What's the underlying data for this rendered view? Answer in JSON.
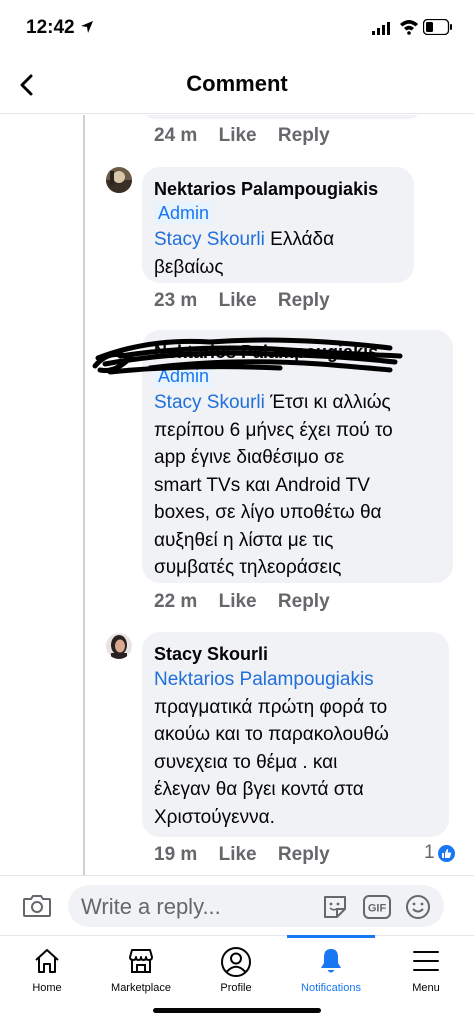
{
  "status_bar": {
    "time": "12:42"
  },
  "header": {
    "title": "Comment"
  },
  "comments": [
    {
      "time": "24 m",
      "like": "Like",
      "reply": "Reply"
    },
    {
      "author": "Nektarios Palampougiakis",
      "badge": "Admin",
      "mention": "Stacy Skourli",
      "text_first": " Ελλάδα",
      "text_lines": [
        "βεβαίως"
      ],
      "time": "23 m",
      "like": "Like",
      "reply": "Reply"
    },
    {
      "author": "Nektarios Palampougiakis",
      "badge": "Admin",
      "mention": "Stacy Skourli",
      "text_first": " Έτσι κι αλλιώς",
      "text_lines": [
        "περίπου 6 μήνες έχει πού το",
        "app έγινε διαθέσιμο σε",
        "smart TVs και Android TV",
        "boxes, σε λίγο υποθέτω θα",
        "αυξηθεί η λίστα με τις",
        "συμβατές τηλεοράσεις"
      ],
      "time": "22 m",
      "like": "Like",
      "reply": "Reply"
    },
    {
      "author": "Stacy Skourli",
      "mention": "Nektarios Palampougiakis",
      "text_lines": [
        "πραγματικά πρώτη φορά το",
        "ακούω και το παρακολουθώ",
        "συνεχεια το θέμα . και",
        "έλεγαν θα βγει κοντά στα",
        "Χριστούγεννα."
      ],
      "time": "19 m",
      "like": "Like",
      "reply": "Reply",
      "reaction_count": "1"
    }
  ],
  "reply_bar": {
    "placeholder": "Write a reply..."
  },
  "tabs": [
    {
      "label": "Home",
      "icon": "home-icon"
    },
    {
      "label": "Marketplace",
      "icon": "marketplace-icon"
    },
    {
      "label": "Profile",
      "icon": "profile-icon"
    },
    {
      "label": "Notifications",
      "icon": "bell-icon",
      "active": true
    },
    {
      "label": "Menu",
      "icon": "menu-icon"
    }
  ],
  "colors": {
    "accent": "#1877f2",
    "mention": "#216fdb",
    "bubble": "#f0f2f5",
    "meta": "#65676b"
  }
}
